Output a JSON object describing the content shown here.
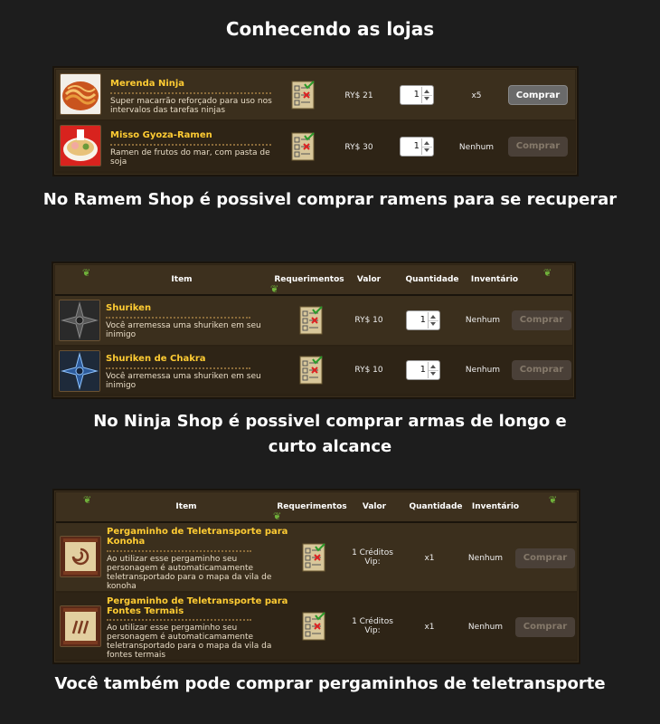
{
  "captions": {
    "title": "Conhecendo as lojas",
    "ramen": "No Ramem Shop é possivel comprar ramens para se recuperar",
    "ninja_line1": "No Ninja  Shop é possivel comprar armas de longo e",
    "ninja_line2": "curto alcance",
    "scroll": "Você também pode comprar pergaminhos de teletransporte"
  },
  "headers": {
    "item": "Item",
    "requirements": "Requerimentos",
    "value": "Valor",
    "quantity": "Quantidade",
    "inventory": "Inventário"
  },
  "ramen_shop": {
    "items": [
      {
        "name": "Merenda Ninja",
        "desc_line1": "Super macarrão reforçado para uso nos",
        "desc_line2": "intervalos das tarefas ninjas",
        "price": "RY$ 21",
        "qty": "1",
        "inventory": "x5",
        "button": "Comprar",
        "enabled": true
      },
      {
        "name": "Misso Gyoza-Ramen",
        "desc_line1": "Ramen de frutos do mar, com pasta de",
        "desc_line2": "soja",
        "price": "RY$ 30",
        "qty": "1",
        "inventory": "Nenhum",
        "button": "Comprar",
        "enabled": false
      }
    ]
  },
  "ninja_shop": {
    "items": [
      {
        "name": "Shuriken",
        "desc_line1": "Você arremessa uma shuriken em seu",
        "desc_line2": "inimigo",
        "price": "RY$ 10",
        "qty": "1",
        "inventory": "Nenhum",
        "button": "Comprar",
        "enabled": false
      },
      {
        "name": "Shuriken de Chakra",
        "desc_line1": "Você arremessa uma shuriken em seu",
        "desc_line2": "inimigo",
        "price": "RY$ 10",
        "qty": "1",
        "inventory": "Nenhum",
        "button": "Comprar",
        "enabled": false
      }
    ]
  },
  "scroll_shop": {
    "items": [
      {
        "name_line1": "Pergaminho de Teletransporte para",
        "name_line2": "Konoha",
        "desc_line1": "Ao utilizar esse pergaminho seu",
        "desc_line2": "personagem é automaticamamente",
        "desc_line3": "teletransportado para o mapa da vila de",
        "desc_line4": "konoha",
        "price_line1": "1 Créditos",
        "price_line2": "Vip:",
        "qty": "x1",
        "inventory": "Nenhum",
        "button": "Comprar",
        "enabled": false
      },
      {
        "name_line1": "Pergaminho de Teletransporte para",
        "name_line2": "Fontes Termais",
        "desc_line1": "Ao utilizar esse pergaminho seu",
        "desc_line2": "personagem é automaticamamente",
        "desc_line3": "teletransportado para o mapa da vila da",
        "desc_line4": "fontes termais",
        "price_line1": "1 Créditos",
        "price_line2": "Vip:",
        "qty": "x1",
        "inventory": "Nenhum",
        "button": "Comprar",
        "enabled": false
      }
    ]
  },
  "colors": {
    "item_name": "#ffcc33",
    "panel_bg": "#2c2214",
    "button_active": "#6a6a6a",
    "button_disabled": "#4a4038"
  }
}
